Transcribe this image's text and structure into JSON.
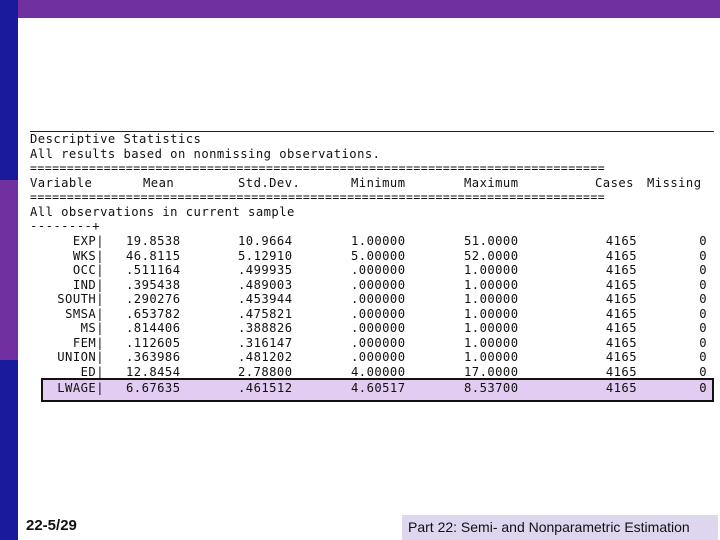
{
  "title": "Descriptive Statistics",
  "subtitle": "All results based on nonmissing observations.",
  "separator": "==============================================================================",
  "header": {
    "variable": "Variable",
    "mean": "Mean",
    "stddev": "Std.Dev.",
    "minimum": "Minimum",
    "maximum": "Maximum",
    "cases": "Cases",
    "missing": "Missing"
  },
  "sample_label": "All observations in current sample",
  "dash_line": "--------+",
  "rows": [
    {
      "variable": "EXP|",
      "mean": "19.8538",
      "stddev": "10.9664",
      "minimum": "1.00000",
      "maximum": "51.0000",
      "cases": "4165",
      "missing": "0"
    },
    {
      "variable": "WKS|",
      "mean": "46.8115",
      "stddev": "5.12910",
      "minimum": "5.00000",
      "maximum": "52.0000",
      "cases": "4165",
      "missing": "0"
    },
    {
      "variable": "OCC|",
      "mean": ".511164",
      "stddev": ".499935",
      "minimum": ".000000",
      "maximum": "1.00000",
      "cases": "4165",
      "missing": "0"
    },
    {
      "variable": "IND|",
      "mean": ".395438",
      "stddev": ".489003",
      "minimum": ".000000",
      "maximum": "1.00000",
      "cases": "4165",
      "missing": "0"
    },
    {
      "variable": "SOUTH|",
      "mean": ".290276",
      "stddev": ".453944",
      "minimum": ".000000",
      "maximum": "1.00000",
      "cases": "4165",
      "missing": "0"
    },
    {
      "variable": "SMSA|",
      "mean": ".653782",
      "stddev": ".475821",
      "minimum": ".000000",
      "maximum": "1.00000",
      "cases": "4165",
      "missing": "0"
    },
    {
      "variable": "MS|",
      "mean": ".814406",
      "stddev": ".388826",
      "minimum": ".000000",
      "maximum": "1.00000",
      "cases": "4165",
      "missing": "0"
    },
    {
      "variable": "FEM|",
      "mean": ".112605",
      "stddev": ".316147",
      "minimum": ".000000",
      "maximum": "1.00000",
      "cases": "4165",
      "missing": "0"
    },
    {
      "variable": "UNION|",
      "mean": ".363986",
      "stddev": ".481202",
      "minimum": ".000000",
      "maximum": "1.00000",
      "cases": "4165",
      "missing": "0"
    },
    {
      "variable": "ED|",
      "mean": "12.8454",
      "stddev": "2.78800",
      "minimum": "4.00000",
      "maximum": "17.0000",
      "cases": "4165",
      "missing": "0"
    },
    {
      "variable": "LWAGE|",
      "mean": "6.67635",
      "stddev": ".461512",
      "minimum": "4.60517",
      "maximum": "8.53700",
      "cases": "4165",
      "missing": "0"
    }
  ],
  "footer": {
    "slide_number": "22-5/29",
    "course_title": "Part 22: Semi- and Nonparametric Estimation"
  },
  "colors": {
    "top_bar": "#7030a0",
    "left_bar": "#1a1a9c",
    "highlight": "#e3ccf2",
    "footer_box": "#ddd6ee"
  }
}
